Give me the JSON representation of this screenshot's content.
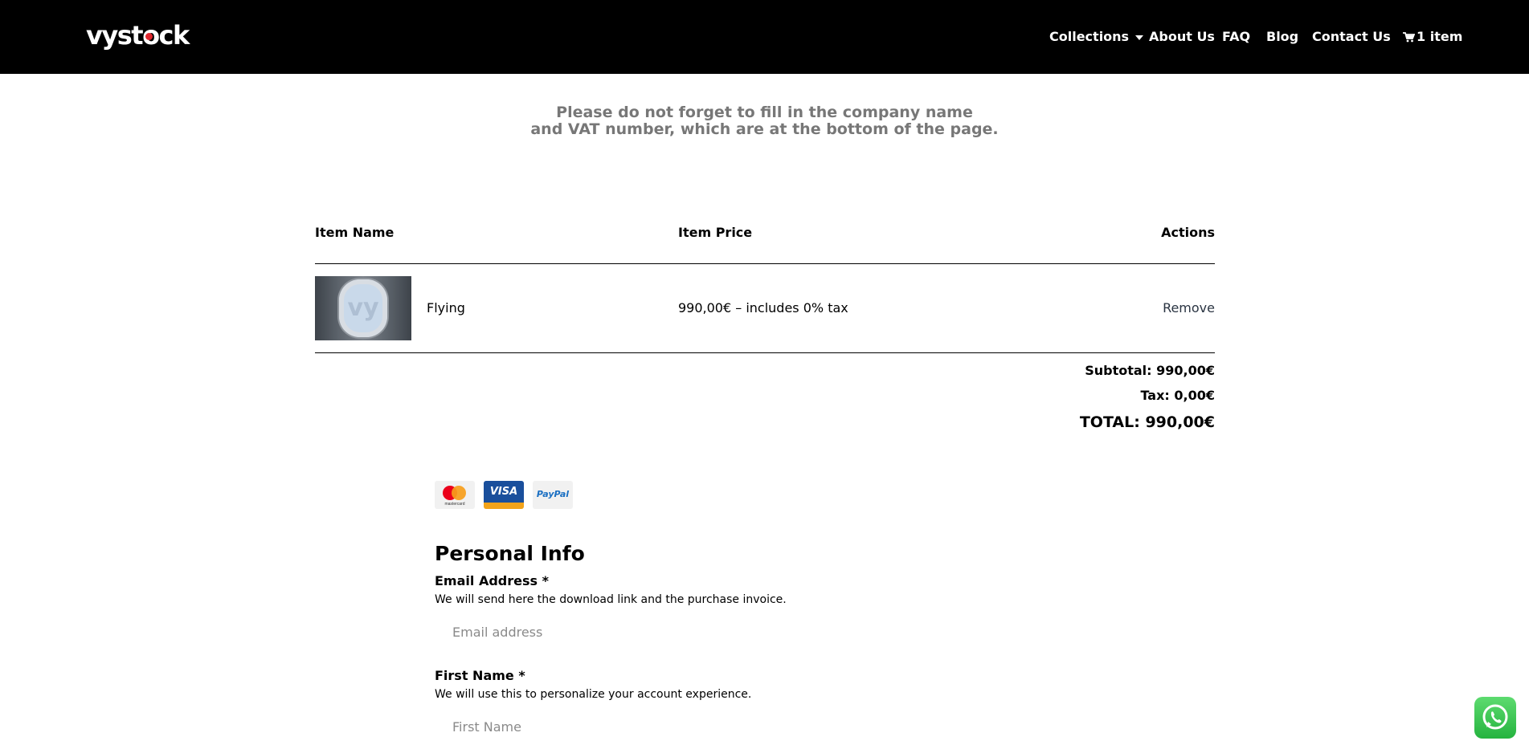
{
  "header": {
    "logo": "vystock",
    "nav": [
      {
        "label": "Collections"
      },
      {
        "label": "About Us"
      },
      {
        "label": "FAQ"
      },
      {
        "label": "Blog"
      },
      {
        "label": "Contact Us"
      }
    ],
    "cart_label": "1 item"
  },
  "notice": {
    "line1": "Please do not forget to fill in the company name",
    "line2": "and VAT number, which are at the bottom of the page."
  },
  "cart": {
    "columns": [
      "Item Name",
      "Item Price",
      "Actions"
    ],
    "items": [
      {
        "name": "Flying",
        "price": "990,00€ – includes 0% tax",
        "action": "Remove"
      }
    ],
    "subtotal": "Subtotal: 990,00€",
    "tax": "Tax: 0,00€",
    "total": "TOTAL: 990,00€"
  },
  "payment_methods": {
    "mastercard": "mastercard",
    "visa": "VISA",
    "paypal": "PayPal"
  },
  "form": {
    "heading": "Personal Info",
    "email": {
      "label": "Email Address *",
      "description": "We will send here the download link and the purchase invoice.",
      "placeholder": "Email address"
    },
    "first_name": {
      "label": "First Name *",
      "description": "We will use this to personalize your account experience.",
      "placeholder": "First Name"
    }
  },
  "colors": {
    "header_bg": "#000000",
    "logo_dot": "#e0262d",
    "whatsapp": "#25d366"
  }
}
